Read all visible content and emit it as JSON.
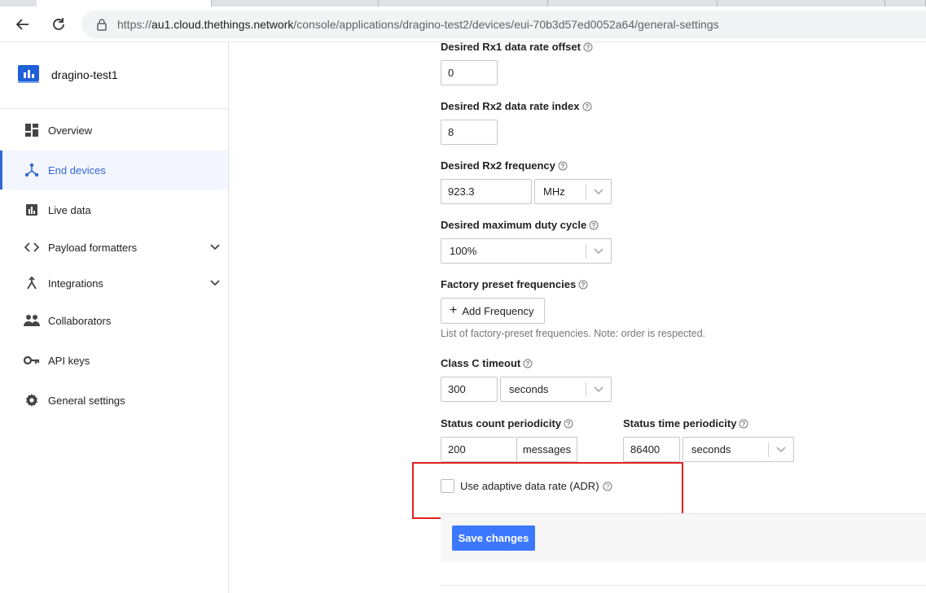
{
  "browser": {
    "url_prefix": "https://",
    "url_host": "au1.cloud.thethings.network",
    "url_path": "/console/applications/dragino-test2/devices/eui-70b3d57ed0052a64/general-settings"
  },
  "app": {
    "name": "dragino-test1"
  },
  "sidebar": {
    "items": [
      {
        "label": "Overview",
        "icon": "dashboard-icon"
      },
      {
        "label": "End devices",
        "icon": "device-hub-icon",
        "active": true
      },
      {
        "label": "Live data",
        "icon": "bar-chart-icon"
      },
      {
        "label": "Payload formatters",
        "icon": "code-icon",
        "expandable": true
      },
      {
        "label": "Integrations",
        "icon": "merge-icon",
        "expandable": true
      },
      {
        "label": "Collaborators",
        "icon": "people-icon"
      },
      {
        "label": "API keys",
        "icon": "key-icon"
      },
      {
        "label": "General settings",
        "icon": "gear-icon"
      }
    ]
  },
  "form": {
    "rx1_offset": {
      "label": "Desired Rx1 data rate offset",
      "value": "0"
    },
    "rx2_index": {
      "label": "Desired Rx2 data rate index",
      "value": "8"
    },
    "rx2_freq": {
      "label": "Desired Rx2 frequency",
      "value": "923.3",
      "unit": "MHz"
    },
    "duty_cycle": {
      "label": "Desired maximum duty cycle",
      "value": "100%"
    },
    "factory_freq": {
      "label": "Factory preset frequencies",
      "button": "Add Frequency",
      "hint": "List of factory-preset frequencies. Note: order is respected."
    },
    "class_c": {
      "label": "Class C timeout",
      "value": "300",
      "unit": "seconds"
    },
    "status_count": {
      "label": "Status count periodicity",
      "value": "200",
      "unit": "messages"
    },
    "status_time": {
      "label": "Status time periodicity",
      "value": "86400",
      "unit": "seconds"
    },
    "adr": {
      "label": "Use adaptive data rate (ADR)",
      "checked": false
    },
    "save": "Save changes"
  },
  "colors": {
    "accent": "#3367d6",
    "primary_button": "#3c78ff",
    "highlight": "#e02020"
  }
}
